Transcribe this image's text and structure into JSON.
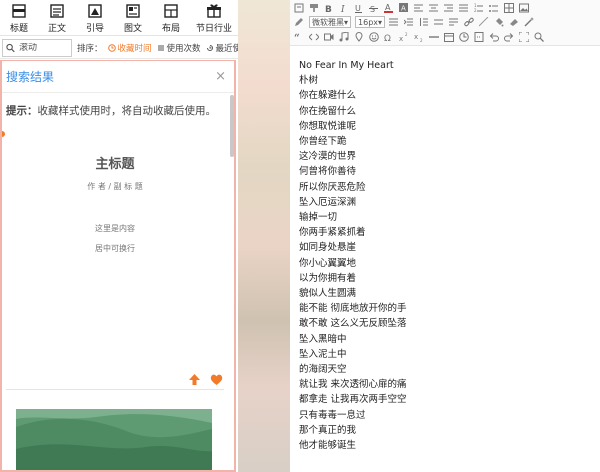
{
  "tabs": [
    {
      "label": "标题",
      "icon": "heading-icon"
    },
    {
      "label": "正文",
      "icon": "text-body-icon"
    },
    {
      "label": "引导",
      "icon": "guide-icon"
    },
    {
      "label": "图文",
      "icon": "image-text-icon"
    },
    {
      "label": "布局",
      "icon": "layout-icon"
    },
    {
      "label": "节日行业",
      "icon": "gift-icon"
    }
  ],
  "filter": {
    "search_placeholder": "滚动",
    "sort_label": "排序：",
    "sort_options": [
      {
        "label": "收藏时间",
        "icon": "clock-icon",
        "active": true
      },
      {
        "label": "使用次数",
        "icon": "list-count-icon",
        "active": false
      },
      {
        "label": "最近使",
        "icon": "history-icon",
        "active": false
      }
    ]
  },
  "results": {
    "title": "搜索结果",
    "close": "×",
    "tip_label": "提示：",
    "tip_text": "收藏样式使用时，将自动收藏后使用。"
  },
  "card": {
    "title": "主标题",
    "subtitle": "作 者 / 副 标 题",
    "body_line1": "这里是内容",
    "body_line2": "居中可换行"
  },
  "editor": {
    "font_family": "微软雅黑",
    "font_size": "16px",
    "lines": [
      "No Fear In My Heart",
      "朴树",
      "你在躲避什么",
      "你在挽留什么",
      "你想取悦谁呢",
      "你曾经下跪",
      "这冷漠的世界",
      "何曾将你善待",
      "所以你厌恶危险",
      "坠入厄运深渊",
      "输掉一切",
      "你两手紧紧抓着",
      "如同身处悬崖",
      "你小心翼翼地",
      "以为你拥有着",
      "貌似人生圆满",
      "能不能 彻底地放开你的手",
      "敢不敢 这么义无反顾坠落",
      "坠入黑暗中",
      "坠入泥土中",
      "的海阔天空",
      "就让我 来次透彻心扉的痛",
      "都拿走 让我再次两手空空",
      "只有毒毒一息过",
      "那个真正的我",
      "他才能够诞生"
    ]
  },
  "colors": {
    "accent": "#3a8ee6",
    "orange": "#f27b2a",
    "panel_border": "#f2b4a8"
  }
}
